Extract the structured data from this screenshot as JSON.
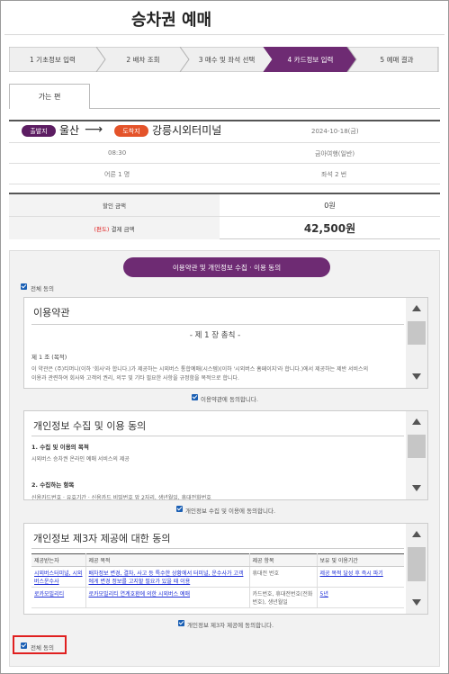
{
  "page": {
    "title": "승차권 예매",
    "steps": [
      {
        "label": "1 기초정보 입력",
        "active": false
      },
      {
        "label": "2 배차 조회",
        "active": false
      },
      {
        "label": "3 매수 및 좌석 선택",
        "active": false
      },
      {
        "label": "4 카드정보 입력",
        "active": true
      },
      {
        "label": "5 예매 결과",
        "active": false
      }
    ],
    "tab": "가는 편"
  },
  "trip": {
    "departure_badge": "출발지",
    "departure": "울산",
    "arrival_badge": "도착지",
    "arrival": "강릉시외터미널",
    "date": "2024-10-18(금)",
    "time": "08:30",
    "company": "금아여행(일반)",
    "passengers": "어른 1 명",
    "seat": "좌석 2 번"
  },
  "fare": {
    "discount_label": "할인 금액",
    "discount_value": "0원",
    "pay_label_prefix": "(편도)",
    "pay_label": "결제 금액",
    "pay_value": "42,500원"
  },
  "terms": {
    "header_button": "이용약관 및 개인정보 수집 · 이용 동의",
    "agree_all_top": "전체 동의",
    "usage": {
      "title": "이용약관",
      "chapter": "- 제 1 장 총칙 -",
      "article": "제 1 조 (목적)",
      "line1": "이 약관은 (주)티머니(이하 '회사'라 합니다.)가 제공하는 시외버스 통합예매(시스템)(이하 '시외버스 홈페이지'라 합니다.)에서 제공하는 제반 서비스의",
      "line2": "이용과 관련하여 회사와 고객의 권리, 의무 및 기타 필요한 사항을 규정함을 목적으로 합니다.",
      "agree": "이용약관에 동의합니다."
    },
    "privacy": {
      "title": "개인정보 수집 및 이용 동의",
      "item1": "1. 수집 및 이용의 목적",
      "item1_desc": "시외버스 승차권 온라인 예매 서비스의 제공",
      "item2": "2. 수집하는 항목",
      "item2_desc": "신용카드번호 · 유효기간 · 신용카드 비밀번호 앞 2자리, 생년월일, 휴대전화번호",
      "agree": "개인정보 수집 및 이용에 동의합니다."
    },
    "third_party": {
      "title": "개인정보 제3자 제공에 대한 동의",
      "headers": [
        "제공받는자",
        "제공 목적",
        "제공 항목",
        "보유 및 이용기간"
      ],
      "rows": [
        [
          "시외버스터미널, 시외버스운수사",
          "배차정보 변경, 결차, 사고 등 특수한 상황에서 터미널, 운수사가 고객에게 변경 정보를 고지할 필요가 있을 때 이용",
          "휴대전 번호",
          "제공 목적 달성 후 즉시 파기"
        ],
        [
          "로카모빌리티",
          "로카모빌리티 연계호환에 의한 시외버스 예매",
          "카드번호, 휴대전번호(전화번호), 생년월일",
          "5년"
        ]
      ],
      "agree": "개인정보 제3자 제공에 동의합니다."
    },
    "agree_all_bottom": "전체 동의"
  },
  "colors": {
    "active_step": "#6e2b73",
    "departure_badge": "#5c1d62",
    "arrival_badge": "#e4532a",
    "checkbox": "#1a5fb4",
    "highlight": "#e02020"
  }
}
